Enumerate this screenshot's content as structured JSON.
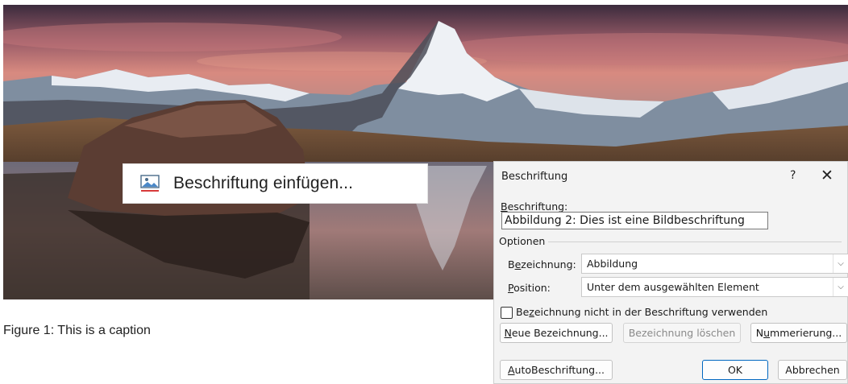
{
  "context_menu": {
    "label_before": "Beschriftun",
    "label_accel": "g",
    "label_after": " einfügen...",
    "icon": "picture-caption-icon"
  },
  "figure_caption": "Figure 1: This is a caption",
  "dialog": {
    "title": "Beschriftung",
    "help": "?",
    "close": "✕",
    "caption_label_accel": "B",
    "caption_label_rest": "eschriftung:",
    "caption_value": "Abbildung 2: Dies ist eine Bildbeschriftung",
    "options_label": "Optionen",
    "designation_label_pre": "B",
    "designation_label_accel": "e",
    "designation_label_post": "zeichnung:",
    "designation_value": "Abbildung",
    "position_label_accel": "P",
    "position_label_rest": "osition:",
    "position_value": "Unter dem ausgewählten Element",
    "checkbox_pre": "Be",
    "checkbox_accel": "z",
    "checkbox_post": "eichnung nicht in der Beschriftung verwenden",
    "checkbox_checked": false,
    "new_label_accel": "N",
    "new_label_rest": "eue Bezeichnung...",
    "delete_label": "Bezeichnung löschen",
    "numbering_pre": "N",
    "numbering_accel": "u",
    "numbering_post": "mmerierung...",
    "autocaption_accel": "A",
    "autocaption_rest": "utoBeschriftung...",
    "ok": "OK",
    "cancel": "Abbrechen",
    "dropdown_arrow": "⌵"
  }
}
